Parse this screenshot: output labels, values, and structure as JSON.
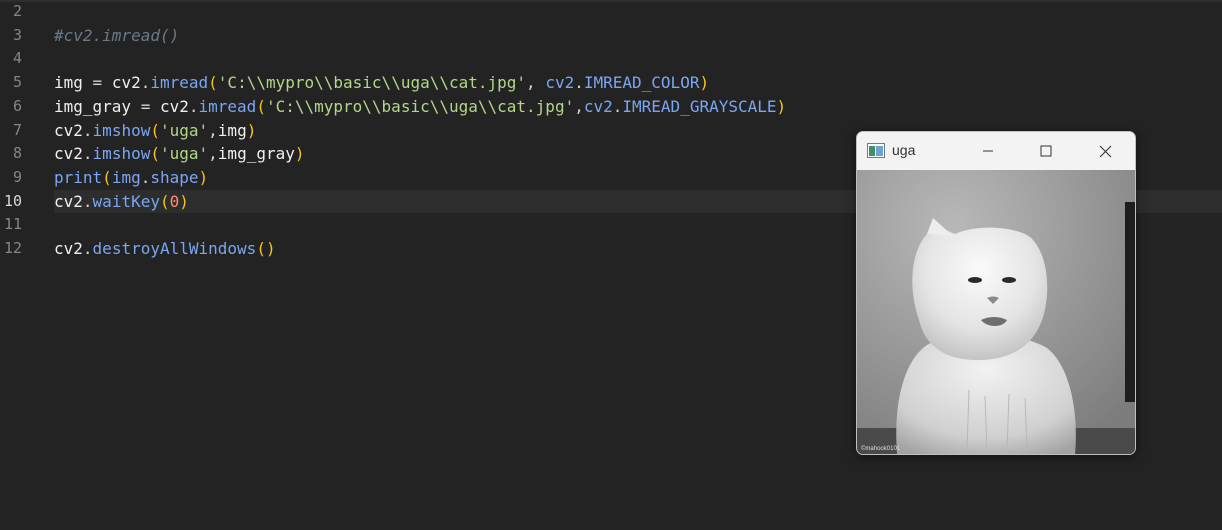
{
  "editor": {
    "lines": [
      {
        "num": "2",
        "tokens": []
      },
      {
        "num": "3",
        "tokens": [
          {
            "t": "#cv2.imread()",
            "c": "tk-comment"
          }
        ]
      },
      {
        "num": "4",
        "tokens": []
      },
      {
        "num": "5",
        "tokens": [
          {
            "t": "img",
            "c": "tk-var"
          },
          {
            "t": " = ",
            "c": "tk-punc"
          },
          {
            "t": "cv2",
            "c": "tk-var"
          },
          {
            "t": ".",
            "c": "tk-punc"
          },
          {
            "t": "imread",
            "c": "tk-fn"
          },
          {
            "t": "(",
            "c": "tk-paren"
          },
          {
            "t": "'C:\\\\mypro\\\\basic\\\\uga\\\\cat.jpg'",
            "c": "tk-str"
          },
          {
            "t": ", ",
            "c": "tk-punc"
          },
          {
            "t": "cv2",
            "c": "tk-const"
          },
          {
            "t": ".",
            "c": "tk-punc"
          },
          {
            "t": "IMREAD_COLOR",
            "c": "tk-const"
          },
          {
            "t": ")",
            "c": "tk-paren"
          }
        ]
      },
      {
        "num": "6",
        "tokens": [
          {
            "t": "img_gray",
            "c": "tk-var"
          },
          {
            "t": " = ",
            "c": "tk-punc"
          },
          {
            "t": "cv2",
            "c": "tk-var"
          },
          {
            "t": ".",
            "c": "tk-punc"
          },
          {
            "t": "imread",
            "c": "tk-fn"
          },
          {
            "t": "(",
            "c": "tk-paren"
          },
          {
            "t": "'C:\\\\mypro\\\\basic\\\\uga\\\\cat.jpg'",
            "c": "tk-str"
          },
          {
            "t": ",",
            "c": "tk-punc"
          },
          {
            "t": "cv2",
            "c": "tk-const"
          },
          {
            "t": ".",
            "c": "tk-punc"
          },
          {
            "t": "IMREAD_GRAYSCALE",
            "c": "tk-const"
          },
          {
            "t": ")",
            "c": "tk-paren"
          }
        ]
      },
      {
        "num": "7",
        "tokens": [
          {
            "t": "cv2",
            "c": "tk-var"
          },
          {
            "t": ".",
            "c": "tk-punc"
          },
          {
            "t": "imshow",
            "c": "tk-fn"
          },
          {
            "t": "(",
            "c": "tk-paren"
          },
          {
            "t": "'uga'",
            "c": "tk-str"
          },
          {
            "t": ",",
            "c": "tk-punc"
          },
          {
            "t": "img",
            "c": "tk-var"
          },
          {
            "t": ")",
            "c": "tk-paren"
          }
        ]
      },
      {
        "num": "8",
        "tokens": [
          {
            "t": "cv2",
            "c": "tk-var"
          },
          {
            "t": ".",
            "c": "tk-punc"
          },
          {
            "t": "imshow",
            "c": "tk-fn"
          },
          {
            "t": "(",
            "c": "tk-paren"
          },
          {
            "t": "'uga'",
            "c": "tk-str"
          },
          {
            "t": ",",
            "c": "tk-punc"
          },
          {
            "t": "img_gray",
            "c": "tk-var"
          },
          {
            "t": ")",
            "c": "tk-paren"
          }
        ]
      },
      {
        "num": "9",
        "tokens": [
          {
            "t": "print",
            "c": "tk-fn"
          },
          {
            "t": "(",
            "c": "tk-paren"
          },
          {
            "t": "img",
            "c": "tk-fn"
          },
          {
            "t": ".",
            "c": "tk-punc"
          },
          {
            "t": "shape",
            "c": "tk-fn"
          },
          {
            "t": ")",
            "c": "tk-paren"
          }
        ]
      },
      {
        "num": "10",
        "current": true,
        "tokens": [
          {
            "t": "cv2",
            "c": "tk-var"
          },
          {
            "t": ".",
            "c": "tk-punc"
          },
          {
            "t": "waitKey",
            "c": "tk-fn"
          },
          {
            "t": "(",
            "c": "tk-paren"
          },
          {
            "t": "0",
            "c": "tk-num"
          },
          {
            "t": ")",
            "c": "tk-paren"
          }
        ]
      },
      {
        "num": "11",
        "tokens": []
      },
      {
        "num": "12",
        "tokens": [
          {
            "t": "cv2",
            "c": "tk-var"
          },
          {
            "t": ".",
            "c": "tk-punc"
          },
          {
            "t": "destroyAllWindows",
            "c": "tk-fn"
          },
          {
            "t": "()",
            "c": "tk-paren"
          }
        ]
      }
    ]
  },
  "image_window": {
    "title": "uga",
    "app_icon": "opencv-window-icon",
    "controls": [
      "minimize-icon",
      "maximize-icon",
      "close-icon"
    ],
    "image_description_icon": "grayscale-cat-photo",
    "watermark": "©mahook0101"
  },
  "colors": {
    "editor_bg": "#232323",
    "current_line_bg": "#2d2d2d",
    "window_chrome": "#f3f3f3"
  }
}
